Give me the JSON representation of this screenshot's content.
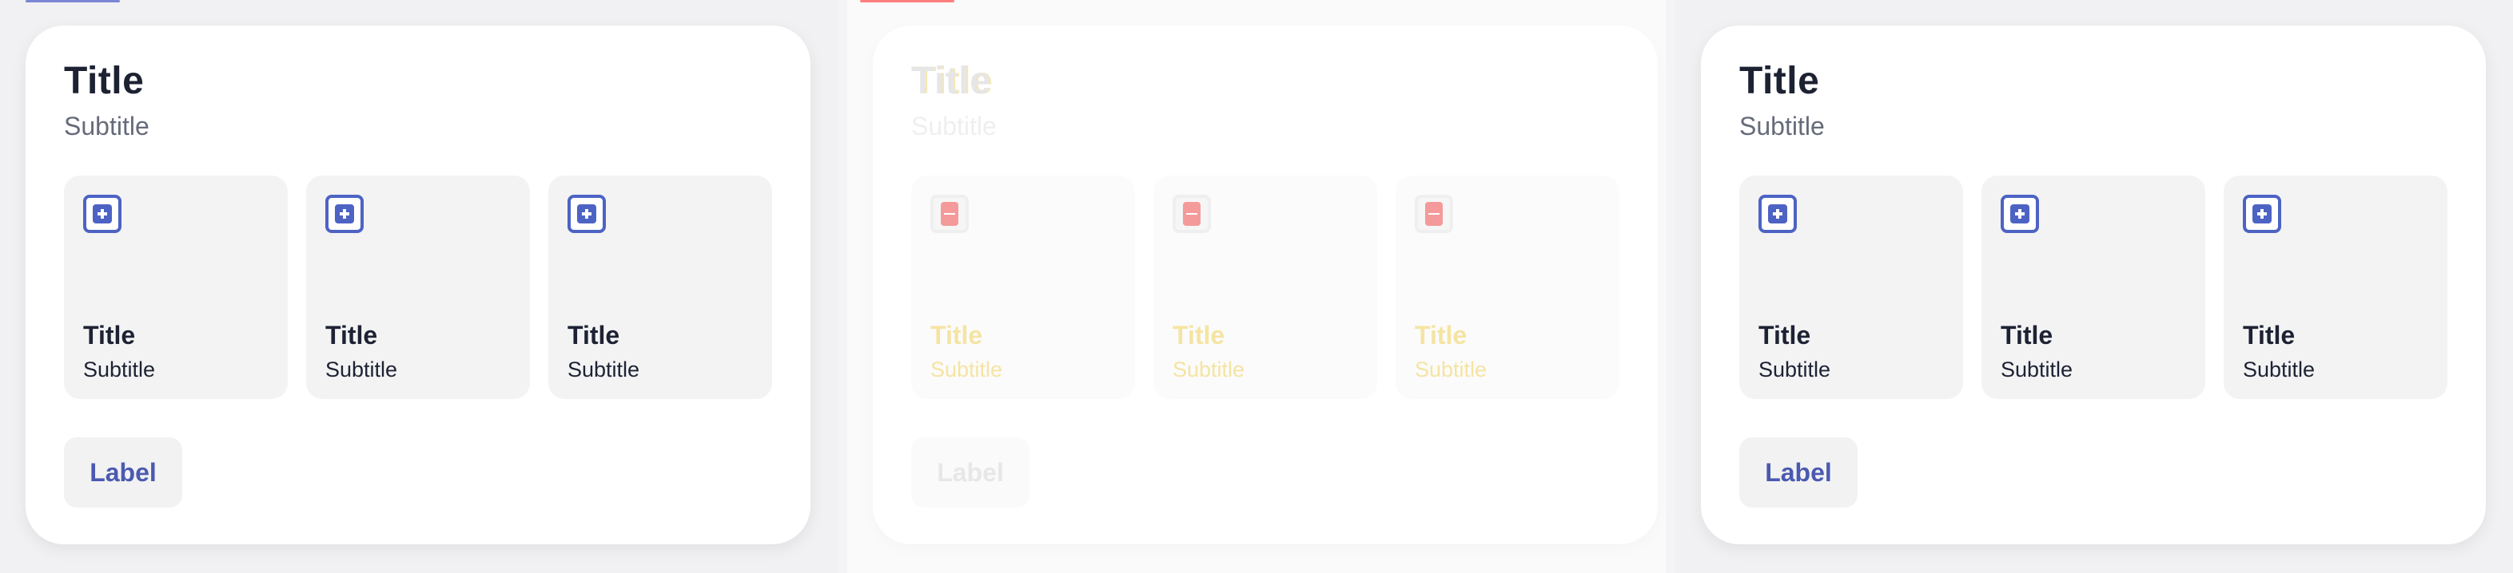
{
  "cards": [
    {
      "title": "Title",
      "subtitle": "Subtitle",
      "tiles": [
        {
          "title": "Title",
          "subtitle": "Subtitle",
          "icon": "add-box-icon"
        },
        {
          "title": "Title",
          "subtitle": "Subtitle",
          "icon": "add-box-icon"
        },
        {
          "title": "Title",
          "subtitle": "Subtitle",
          "icon": "add-box-icon"
        }
      ],
      "button_label": "Label"
    },
    {
      "title": "Title",
      "subtitle": "Subtitle",
      "tiles": [
        {
          "title": "Title",
          "subtitle": "Subtitle",
          "icon": "document-icon"
        },
        {
          "title": "Title",
          "subtitle": "Subtitle",
          "icon": "document-icon"
        },
        {
          "title": "Title",
          "subtitle": "Subtitle",
          "icon": "document-icon"
        }
      ],
      "button_label": "Label"
    },
    {
      "title": "Title",
      "subtitle": "Subtitle",
      "tiles": [
        {
          "title": "Title",
          "subtitle": "Subtitle",
          "icon": "add-box-icon"
        },
        {
          "title": "Title",
          "subtitle": "Subtitle",
          "icon": "add-box-icon"
        },
        {
          "title": "Title",
          "subtitle": "Subtitle",
          "icon": "add-box-icon"
        }
      ],
      "button_label": "Label"
    }
  ],
  "colors": {
    "accent": "#4d63c4",
    "button_text": "#4b5aaf",
    "title_text": "#1d2233",
    "subtitle_text": "#666b7a"
  }
}
